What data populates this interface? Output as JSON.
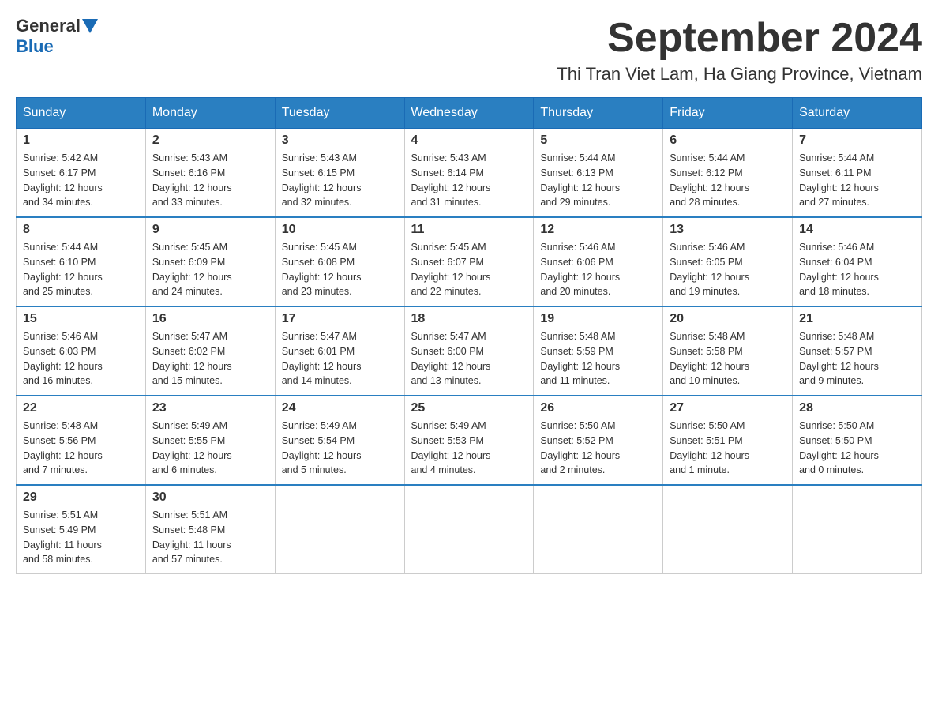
{
  "logo": {
    "general": "General",
    "blue": "Blue"
  },
  "header": {
    "title": "September 2024",
    "subtitle": "Thi Tran Viet Lam, Ha Giang Province, Vietnam"
  },
  "days_of_week": [
    "Sunday",
    "Monday",
    "Tuesday",
    "Wednesday",
    "Thursday",
    "Friday",
    "Saturday"
  ],
  "weeks": [
    [
      {
        "day": "1",
        "sunrise": "5:42 AM",
        "sunset": "6:17 PM",
        "daylight": "12 hours and 34 minutes."
      },
      {
        "day": "2",
        "sunrise": "5:43 AM",
        "sunset": "6:16 PM",
        "daylight": "12 hours and 33 minutes."
      },
      {
        "day": "3",
        "sunrise": "5:43 AM",
        "sunset": "6:15 PM",
        "daylight": "12 hours and 32 minutes."
      },
      {
        "day": "4",
        "sunrise": "5:43 AM",
        "sunset": "6:14 PM",
        "daylight": "12 hours and 31 minutes."
      },
      {
        "day": "5",
        "sunrise": "5:44 AM",
        "sunset": "6:13 PM",
        "daylight": "12 hours and 29 minutes."
      },
      {
        "day": "6",
        "sunrise": "5:44 AM",
        "sunset": "6:12 PM",
        "daylight": "12 hours and 28 minutes."
      },
      {
        "day": "7",
        "sunrise": "5:44 AM",
        "sunset": "6:11 PM",
        "daylight": "12 hours and 27 minutes."
      }
    ],
    [
      {
        "day": "8",
        "sunrise": "5:44 AM",
        "sunset": "6:10 PM",
        "daylight": "12 hours and 25 minutes."
      },
      {
        "day": "9",
        "sunrise": "5:45 AM",
        "sunset": "6:09 PM",
        "daylight": "12 hours and 24 minutes."
      },
      {
        "day": "10",
        "sunrise": "5:45 AM",
        "sunset": "6:08 PM",
        "daylight": "12 hours and 23 minutes."
      },
      {
        "day": "11",
        "sunrise": "5:45 AM",
        "sunset": "6:07 PM",
        "daylight": "12 hours and 22 minutes."
      },
      {
        "day": "12",
        "sunrise": "5:46 AM",
        "sunset": "6:06 PM",
        "daylight": "12 hours and 20 minutes."
      },
      {
        "day": "13",
        "sunrise": "5:46 AM",
        "sunset": "6:05 PM",
        "daylight": "12 hours and 19 minutes."
      },
      {
        "day": "14",
        "sunrise": "5:46 AM",
        "sunset": "6:04 PM",
        "daylight": "12 hours and 18 minutes."
      }
    ],
    [
      {
        "day": "15",
        "sunrise": "5:46 AM",
        "sunset": "6:03 PM",
        "daylight": "12 hours and 16 minutes."
      },
      {
        "day": "16",
        "sunrise": "5:47 AM",
        "sunset": "6:02 PM",
        "daylight": "12 hours and 15 minutes."
      },
      {
        "day": "17",
        "sunrise": "5:47 AM",
        "sunset": "6:01 PM",
        "daylight": "12 hours and 14 minutes."
      },
      {
        "day": "18",
        "sunrise": "5:47 AM",
        "sunset": "6:00 PM",
        "daylight": "12 hours and 13 minutes."
      },
      {
        "day": "19",
        "sunrise": "5:48 AM",
        "sunset": "5:59 PM",
        "daylight": "12 hours and 11 minutes."
      },
      {
        "day": "20",
        "sunrise": "5:48 AM",
        "sunset": "5:58 PM",
        "daylight": "12 hours and 10 minutes."
      },
      {
        "day": "21",
        "sunrise": "5:48 AM",
        "sunset": "5:57 PM",
        "daylight": "12 hours and 9 minutes."
      }
    ],
    [
      {
        "day": "22",
        "sunrise": "5:48 AM",
        "sunset": "5:56 PM",
        "daylight": "12 hours and 7 minutes."
      },
      {
        "day": "23",
        "sunrise": "5:49 AM",
        "sunset": "5:55 PM",
        "daylight": "12 hours and 6 minutes."
      },
      {
        "day": "24",
        "sunrise": "5:49 AM",
        "sunset": "5:54 PM",
        "daylight": "12 hours and 5 minutes."
      },
      {
        "day": "25",
        "sunrise": "5:49 AM",
        "sunset": "5:53 PM",
        "daylight": "12 hours and 4 minutes."
      },
      {
        "day": "26",
        "sunrise": "5:50 AM",
        "sunset": "5:52 PM",
        "daylight": "12 hours and 2 minutes."
      },
      {
        "day": "27",
        "sunrise": "5:50 AM",
        "sunset": "5:51 PM",
        "daylight": "12 hours and 1 minute."
      },
      {
        "day": "28",
        "sunrise": "5:50 AM",
        "sunset": "5:50 PM",
        "daylight": "12 hours and 0 minutes."
      }
    ],
    [
      {
        "day": "29",
        "sunrise": "5:51 AM",
        "sunset": "5:49 PM",
        "daylight": "11 hours and 58 minutes."
      },
      {
        "day": "30",
        "sunrise": "5:51 AM",
        "sunset": "5:48 PM",
        "daylight": "11 hours and 57 minutes."
      },
      null,
      null,
      null,
      null,
      null
    ]
  ],
  "labels": {
    "sunrise_prefix": "Sunrise: ",
    "sunset_prefix": "Sunset: ",
    "daylight_prefix": "Daylight: "
  }
}
